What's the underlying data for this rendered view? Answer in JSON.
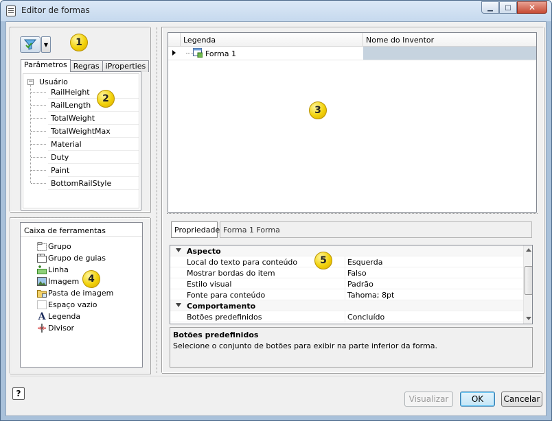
{
  "window": {
    "title": "Editor de formas",
    "controls": {
      "minimize": "▭",
      "maximize": "□",
      "close": "✕"
    }
  },
  "left_panel": {
    "tabs": [
      "Parâmetros",
      "Regras",
      "iProperties"
    ],
    "active_tab": "Parâmetros",
    "tree": {
      "root": "Usuário",
      "items": [
        "RailHeight",
        "RailLength",
        "TotalWeight",
        "TotalWeightMax",
        "Material",
        "Duty",
        "Paint",
        "BottomRailStyle"
      ]
    },
    "toolbox": {
      "title": "Caixa de ferramentas",
      "items": [
        {
          "label": "Grupo",
          "icon": "group-icon"
        },
        {
          "label": "Grupo de guias",
          "icon": "tab-group-icon"
        },
        {
          "label": "Linha",
          "icon": "row-icon"
        },
        {
          "label": "Imagem",
          "icon": "image-icon"
        },
        {
          "label": "Pasta de imagem",
          "icon": "image-folder-icon"
        },
        {
          "label": "Espaço vazio",
          "icon": "empty-space-icon"
        },
        {
          "label": "Legenda",
          "icon": "label-icon"
        },
        {
          "label": "Divisor",
          "icon": "splitter-icon"
        }
      ]
    }
  },
  "form_grid": {
    "columns": [
      "Legenda",
      "Nome do Inventor"
    ],
    "rows": [
      {
        "label": "Forma 1",
        "inventor_name": ""
      }
    ]
  },
  "properties": {
    "header_label": "Propriedade",
    "header_value": "Forma 1 Forma",
    "groups": [
      {
        "name": "Aspecto",
        "rows": [
          {
            "name": "Local do texto para conteúdo",
            "value": "Esquerda"
          },
          {
            "name": "Mostrar bordas do item",
            "value": "Falso"
          },
          {
            "name": "Estilo visual",
            "value": "Padrão"
          },
          {
            "name": "Fonte para conteúdo",
            "value": "Tahoma; 8pt"
          }
        ]
      },
      {
        "name": "Comportamento",
        "rows": [
          {
            "name": "Botões predefinidos",
            "value": "Concluído"
          }
        ]
      }
    ],
    "help_title": "Botões predefinidos",
    "help_text": "Selecione o conjunto de botões para exibir na parte inferior da forma."
  },
  "callouts": [
    "1",
    "2",
    "3",
    "4",
    "5"
  ],
  "footer": {
    "help": "?",
    "preview": "Visualizar",
    "ok": "OK",
    "cancel": "Cancelar"
  },
  "colors": {
    "callout": "#f2d20a",
    "selection": "#c6d3df",
    "default_button": "#c4e5f6"
  }
}
